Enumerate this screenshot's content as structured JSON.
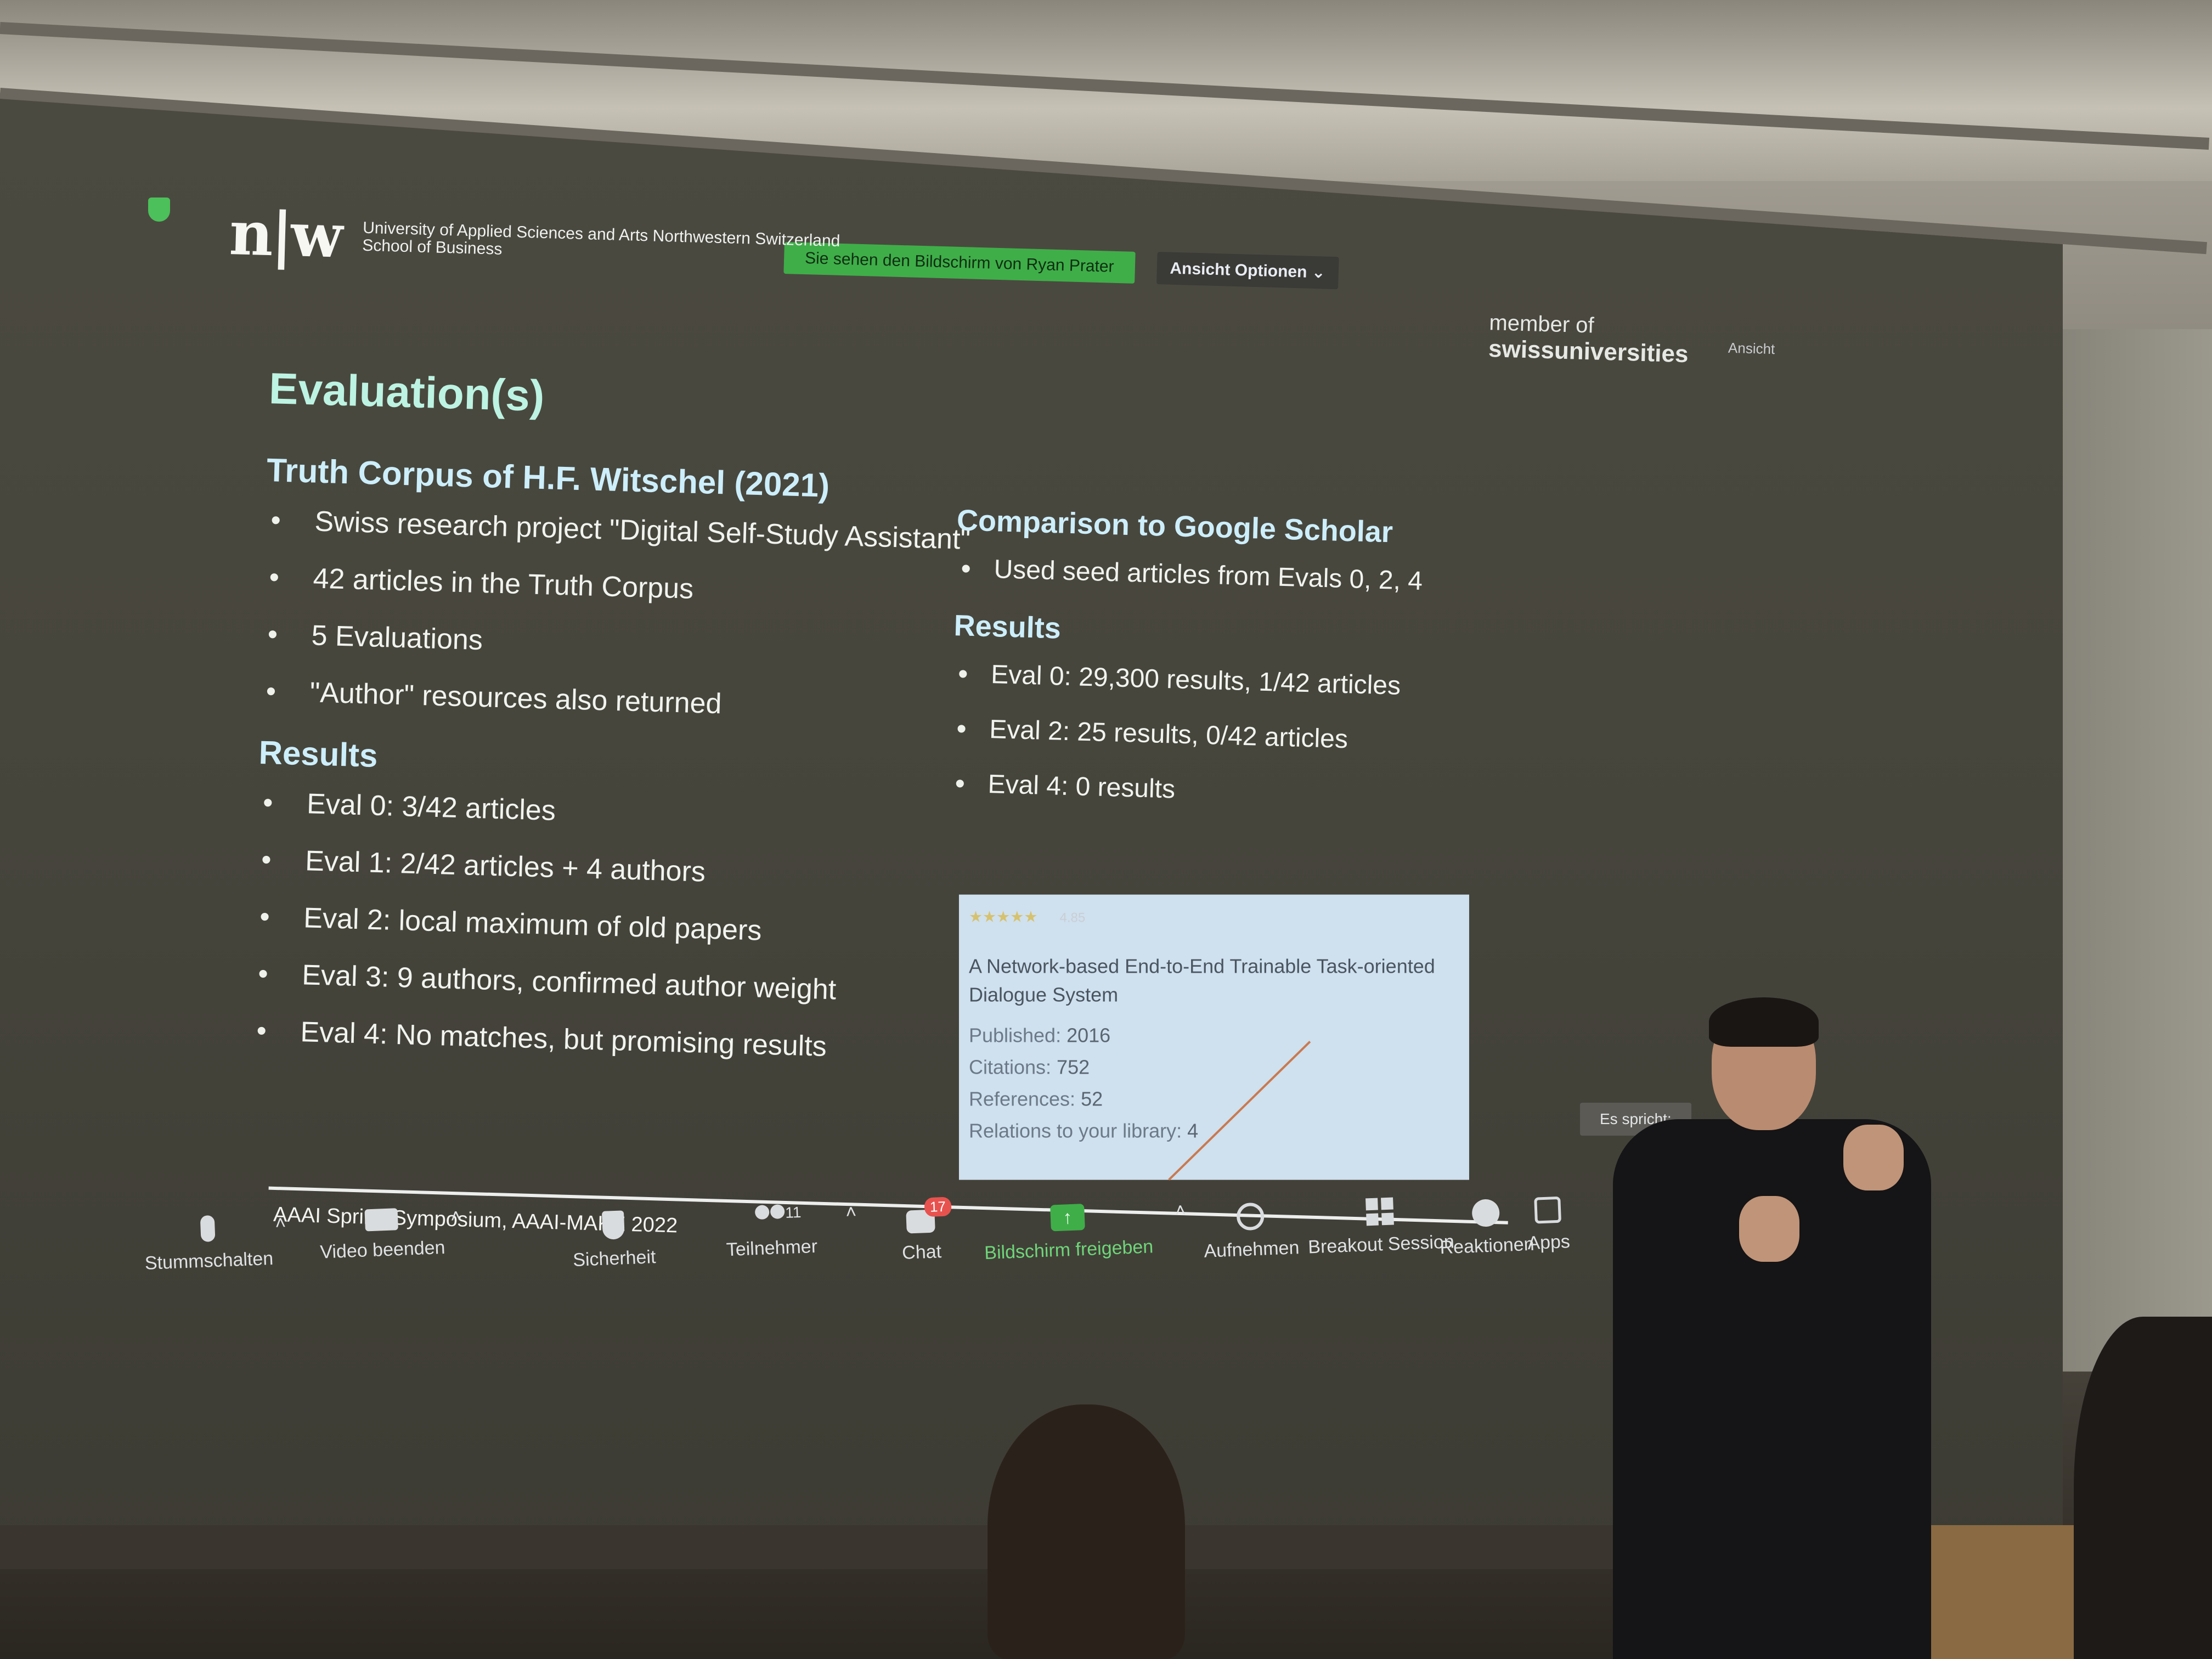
{
  "zoom": {
    "sharing_banner": "Sie sehen den Bildschirm von Ryan Prater",
    "view_options": "Ansicht Optionen ⌄",
    "view_right": "Ansicht",
    "active_speaker_label": "Es spricht:",
    "toolbar": [
      {
        "name": "mute",
        "label": "Stummschalten",
        "icon": "microphone-icon"
      },
      {
        "name": "video",
        "label": "Video beenden",
        "icon": "camera-icon"
      },
      {
        "name": "security",
        "label": "Sicherheit",
        "icon": "shield-icon"
      },
      {
        "name": "participants",
        "label": "Teilnehmer",
        "icon": "participants-icon",
        "count": "11"
      },
      {
        "name": "chat",
        "label": "Chat",
        "icon": "chat-icon",
        "badge": "17"
      },
      {
        "name": "share",
        "label": "Bildschirm freigeben",
        "icon": "share-screen-icon"
      },
      {
        "name": "record",
        "label": "Aufnehmen",
        "icon": "record-icon"
      },
      {
        "name": "breakout",
        "label": "Breakout Session",
        "icon": "breakout-icon"
      },
      {
        "name": "reactions",
        "label": "Reaktionen",
        "icon": "reactions-icon"
      },
      {
        "name": "apps",
        "label": "Apps",
        "icon": "apps-icon"
      }
    ],
    "share_color": "#3fae49"
  },
  "slide": {
    "logo_mark": "n|w",
    "logo_line1": "University of Applied Sciences and Arts Northwestern Switzerland",
    "logo_line2": "School of Business",
    "member_line1": "member of",
    "member_line2": "swissuniversities",
    "title": "Evaluation(s)",
    "left": {
      "heading": "Truth Corpus of H.F. Witschel (2021)",
      "bullets": [
        "Swiss research project \"Digital Self-Study Assistant\"",
        "42 articles in the Truth Corpus",
        "5 Evaluations",
        "\"Author\" resources also returned"
      ],
      "results_heading": "Results",
      "results": [
        "Eval 0: 3/42 articles",
        "Eval 1: 2/42 articles + 4 authors",
        "Eval 2: local maximum of old papers",
        "Eval 3: 9 authors, confirmed author weight",
        "Eval 4: No matches, but promising results"
      ]
    },
    "right": {
      "heading": "Comparison to Google Scholar",
      "bullets": [
        "Used seed articles from Evals 0, 2, 4"
      ],
      "results_heading": "Results",
      "results": [
        "Eval 0: 29,300 results, 1/42 articles",
        "Eval 2: 25 results, 0/42 articles",
        "Eval 4: 0 results"
      ]
    },
    "card": {
      "stars": "★★★★★",
      "rating": "4.85",
      "paper_title": "A Network-based End-to-End Trainable Task-oriented Dialogue System",
      "published_label": "Published:",
      "published": "2016",
      "citations_label": "Citations:",
      "citations": "752",
      "references_label": "References:",
      "references": "52",
      "relations_label": "Relations to your library:",
      "relations": "4"
    },
    "footer": "AAAI Spring Symposium, AAAI-MAKE 2022",
    "title_color": "#bdf3e2",
    "heading_color": "#cdeefb"
  }
}
